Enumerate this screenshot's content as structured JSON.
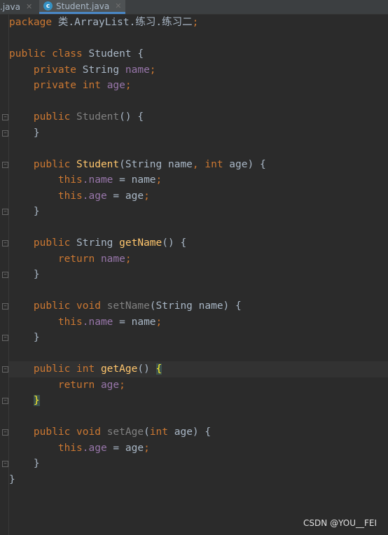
{
  "tabs": [
    {
      "label": "二.java",
      "active": false
    },
    {
      "label": "Student.java",
      "active": true,
      "icon": "class-icon"
    }
  ],
  "close_glyph": "✕",
  "code": [
    [
      [
        "kw",
        "package "
      ],
      [
        "",
        "类.ArrayList.练习.练习二"
      ],
      [
        "kw",
        ";"
      ]
    ],
    [],
    [
      [
        "kw",
        "public class "
      ],
      [
        "",
        "Student {"
      ]
    ],
    [
      [
        "kw",
        "    private "
      ],
      [
        "",
        "String "
      ],
      [
        "fd",
        "name"
      ],
      [
        "kw",
        ";"
      ]
    ],
    [
      [
        "kw",
        "    private int "
      ],
      [
        "fd",
        "age"
      ],
      [
        "kw",
        ";"
      ]
    ],
    [],
    [
      [
        "kw",
        "    public "
      ],
      [
        "un",
        "Student"
      ],
      [
        "",
        "() {"
      ]
    ],
    [
      [
        "",
        "    }"
      ]
    ],
    [],
    [
      [
        "kw",
        "    public "
      ],
      [
        "mt",
        "Student"
      ],
      [
        "",
        "(String name"
      ],
      [
        "kw",
        ", int "
      ],
      [
        "",
        "age) {"
      ]
    ],
    [
      [
        "kw",
        "        this"
      ],
      [
        "",
        ""
      ],
      [
        "fd",
        ".name"
      ],
      [
        "",
        " = name"
      ],
      [
        "kw",
        ";"
      ]
    ],
    [
      [
        "kw",
        "        this"
      ],
      [
        "fd",
        ".age"
      ],
      [
        "",
        " = age"
      ],
      [
        "kw",
        ";"
      ]
    ],
    [
      [
        "",
        "    }"
      ]
    ],
    [],
    [
      [
        "kw",
        "    public "
      ],
      [
        "",
        "String "
      ],
      [
        "mt",
        "getName"
      ],
      [
        "",
        "() {"
      ]
    ],
    [
      [
        "kw",
        "        return "
      ],
      [
        "fd",
        "name"
      ],
      [
        "kw",
        ";"
      ]
    ],
    [
      [
        "",
        "    }"
      ]
    ],
    [],
    [
      [
        "kw",
        "    public void "
      ],
      [
        "un",
        "setName"
      ],
      [
        "",
        "(String name) {"
      ]
    ],
    [
      [
        "kw",
        "        this"
      ],
      [
        "fd",
        ".name"
      ],
      [
        "",
        " = name"
      ],
      [
        "kw",
        ";"
      ]
    ],
    [
      [
        "",
        "    }"
      ]
    ],
    [],
    [
      [
        "kw",
        "    public int "
      ],
      [
        "mt",
        "getAge"
      ],
      [
        "",
        "() "
      ],
      [
        "br",
        "{"
      ]
    ],
    [
      [
        "kw",
        "        return "
      ],
      [
        "fd",
        "age"
      ],
      [
        "kw",
        ";"
      ]
    ],
    [
      [
        "",
        "    "
      ],
      [
        "br",
        "}"
      ]
    ],
    [],
    [
      [
        "kw",
        "    public void "
      ],
      [
        "un",
        "setAge"
      ],
      [
        "",
        "("
      ],
      [
        "kw",
        "int "
      ],
      [
        "",
        "age) {"
      ]
    ],
    [
      [
        "kw",
        "        this"
      ],
      [
        "fd",
        ".age"
      ],
      [
        "",
        " = age"
      ],
      [
        "kw",
        ";"
      ]
    ],
    [
      [
        "",
        "    }"
      ]
    ],
    [
      [
        "",
        "}"
      ]
    ]
  ],
  "current_line": 22,
  "watermark": "CSDN @YOU__FEI"
}
